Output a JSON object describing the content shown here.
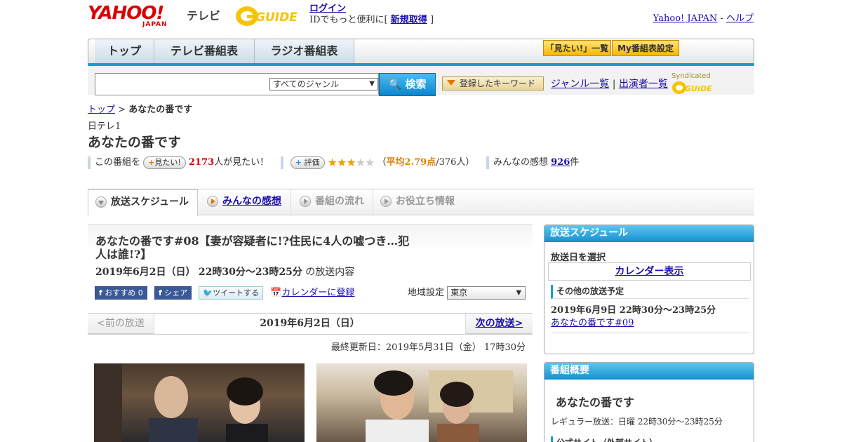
{
  "header": {
    "logo_text": "YAHOO!",
    "logo_sub": "JAPAN",
    "tv_label": "テレビ",
    "gguide_text": "G GUIDE",
    "login_link": "ログイン",
    "login_note_prefix": "IDでもっと便利に[",
    "signup_link": "新規取得",
    "login_note_suffix": "]",
    "yahoo_japan_link": "Yahoo! JAPAN",
    "help_sep": "-",
    "help_link": "ヘルプ"
  },
  "nav": {
    "tabs": [
      "トップ",
      "テレビ番組表",
      "ラジオ番組表"
    ],
    "mitai_list": "「見たい!」一覧",
    "my_schedule": "My番組表設定"
  },
  "search": {
    "genre_value": "すべてのジャンル",
    "search_button": "検索",
    "keyword_button": "登録したキーワード",
    "genre_list_link": "ジャンル一覧",
    "links_sep": "|",
    "cast_list_link": "出演者一覧",
    "syndicated": "Syndicated"
  },
  "breadcrumb": {
    "top": "トップ",
    "sep": ">",
    "current": "あなたの番です"
  },
  "program": {
    "channel": "日テレ1",
    "title": "あなたの番です",
    "mitai_prefix": "この番組を",
    "mitai_button": "見たい!",
    "mitai_count": "2173",
    "mitai_suffix": "人が見たい！",
    "rate_button": "評価",
    "rating": 2.79,
    "rating_open": "（",
    "rating_avg": "平均2.79点",
    "rating_count": "/376人）",
    "impressions_prefix": "みんなの感想",
    "impressions_count": "926",
    "impressions_suffix": "件"
  },
  "tabs": [
    "放送スケジュール",
    "みんなの感想",
    "番組の流れ",
    "お役立ち情報"
  ],
  "episode": {
    "title": "あなたの番です#08【妻が容疑者に!?住民に4人の嘘つき…犯人は誰!?】",
    "date": "2019年6月2日（日）",
    "time": "22時30分～23時25分",
    "date_suffix": "の放送内容",
    "fb_recommend": "おすすめ 0",
    "fb_share": "シェア",
    "tweet": "ツイートする",
    "calendar_add": "カレンダーに登録",
    "region_label": "地域設定",
    "region_value": "東京"
  },
  "pager": {
    "prev": "<前の放送",
    "current": "2019年6月2日（日）",
    "next": "次の放送>"
  },
  "updated": "最終更新日：2019年5月31日（金）  17時30分",
  "sidebar": {
    "schedule_head": "放送スケジュール",
    "select_date": "放送日を選択",
    "calendar_button": "カレンダー表示",
    "other_head": "その他の放送予定",
    "other_date": "2019年6月9日  22時30分～23時25分",
    "other_link": "あなたの番です#09",
    "summary_head": "番組概要",
    "summary_title": "あなたの番です",
    "summary_regular": "レギュラー放送：日曜 22時30分～23時25分",
    "summary_official": "公式サイト（外部サイト）"
  },
  "colors": {
    "accent_blue": "#1a9ad6",
    "yahoo_red": "#dd0000",
    "gguide_yellow": "#f5c400"
  }
}
